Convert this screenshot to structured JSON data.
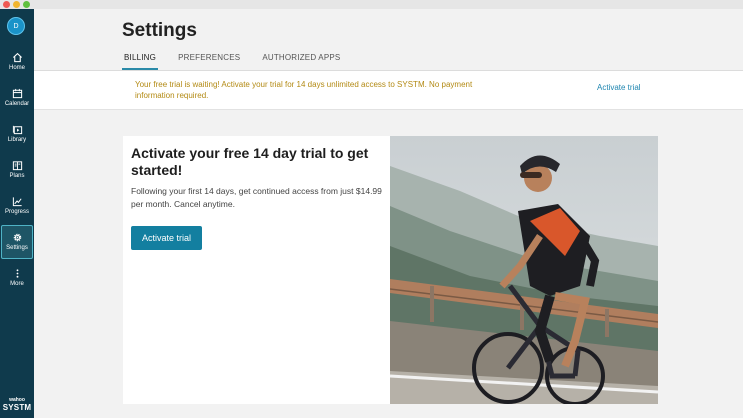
{
  "window": {
    "controls": [
      "close",
      "minimize",
      "maximize"
    ]
  },
  "sidebar": {
    "avatar_initial": "D",
    "items": [
      {
        "label": "Home",
        "icon": "home-icon"
      },
      {
        "label": "Calendar",
        "icon": "calendar-icon"
      },
      {
        "label": "Library",
        "icon": "library-icon"
      },
      {
        "label": "Plans",
        "icon": "plans-icon"
      },
      {
        "label": "Progress",
        "icon": "progress-icon"
      },
      {
        "label": "Settings",
        "icon": "gear-icon",
        "active": true
      },
      {
        "label": "More",
        "icon": "more-icon"
      }
    ],
    "brand_top": "wahoo",
    "brand_bottom": "SYSTM"
  },
  "header": {
    "title": "Settings",
    "tabs": [
      {
        "label": "BILLING",
        "active": true
      },
      {
        "label": "PREFERENCES"
      },
      {
        "label": "AUTHORIZED APPS"
      }
    ]
  },
  "banner": {
    "message": "Your free trial is waiting! Activate your trial for 14 days unlimited access to SYSTM. No payment information required.",
    "link_label": "Activate trial"
  },
  "card": {
    "heading": "Activate your free 14 day trial to get started!",
    "subtext": "Following your first 14 days, get continued access from just $14.99 per month. Cancel anytime.",
    "button_label": "Activate trial"
  },
  "colors": {
    "sidebar_bg": "#0f3a4c",
    "accent": "#137fa0",
    "banner_text": "#b38a14",
    "link": "#1f86b1"
  }
}
